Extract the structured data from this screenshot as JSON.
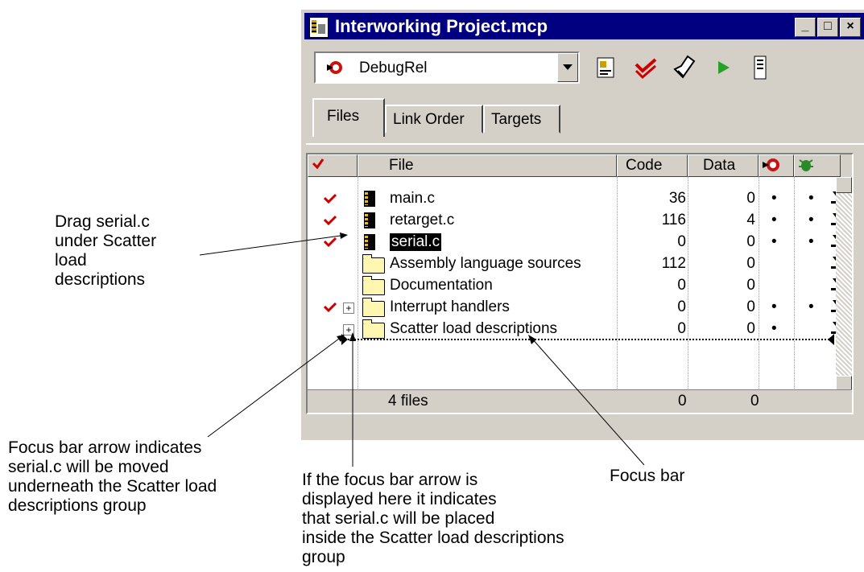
{
  "window": {
    "title": "Interworking Project.mcp"
  },
  "toolbar": {
    "target_value": "DebugRel"
  },
  "tabs": [
    "Files",
    "Link Order",
    "Targets"
  ],
  "columns": {
    "file": "File",
    "code": "Code",
    "data": "Data"
  },
  "rows": [
    {
      "name": "main.c",
      "code": "36",
      "data": "0",
      "b1": "•",
      "b2": "•",
      "checked": true,
      "type": "file"
    },
    {
      "name": "retarget.c",
      "code": "116",
      "data": "4",
      "b1": "•",
      "b2": "•",
      "checked": true,
      "type": "file"
    },
    {
      "name": "serial.c",
      "code": "0",
      "data": "0",
      "b1": "•",
      "b2": "•",
      "checked": true,
      "type": "file",
      "selected": true
    },
    {
      "name": "Assembly language sources",
      "code": "112",
      "data": "0",
      "b1": "",
      "b2": "",
      "checked": false,
      "type": "folder"
    },
    {
      "name": "Documentation",
      "code": "0",
      "data": "0",
      "b1": "",
      "b2": "",
      "checked": false,
      "type": "folder"
    },
    {
      "name": "Interrupt handlers",
      "code": "0",
      "data": "0",
      "b1": "•",
      "b2": "•",
      "checked": true,
      "type": "folder",
      "expandable": true
    },
    {
      "name": "Scatter load descriptions",
      "code": "0",
      "data": "0",
      "b1": "•",
      "b2": "",
      "checked": false,
      "type": "folder",
      "expandable": true
    }
  ],
  "status": {
    "files": "4 files",
    "code": "0",
    "data": "0"
  },
  "annotations": {
    "drag": [
      "Drag serial.c",
      "under Scatter",
      "load",
      "descriptions"
    ],
    "focus_arrow": [
      "Focus bar arrow indicates",
      "serial.c will be moved",
      "underneath the Scatter load",
      "descriptions group"
    ],
    "focus_inside": [
      "If the focus bar arrow is",
      "displayed here it indicates",
      "that serial.c will be placed",
      "inside the Scatter load descriptions",
      "group"
    ],
    "focus_bar": "Focus bar"
  },
  "colors": {
    "title_bar": "#000080",
    "check": "#cc0000",
    "folder": "#fff6b0"
  }
}
